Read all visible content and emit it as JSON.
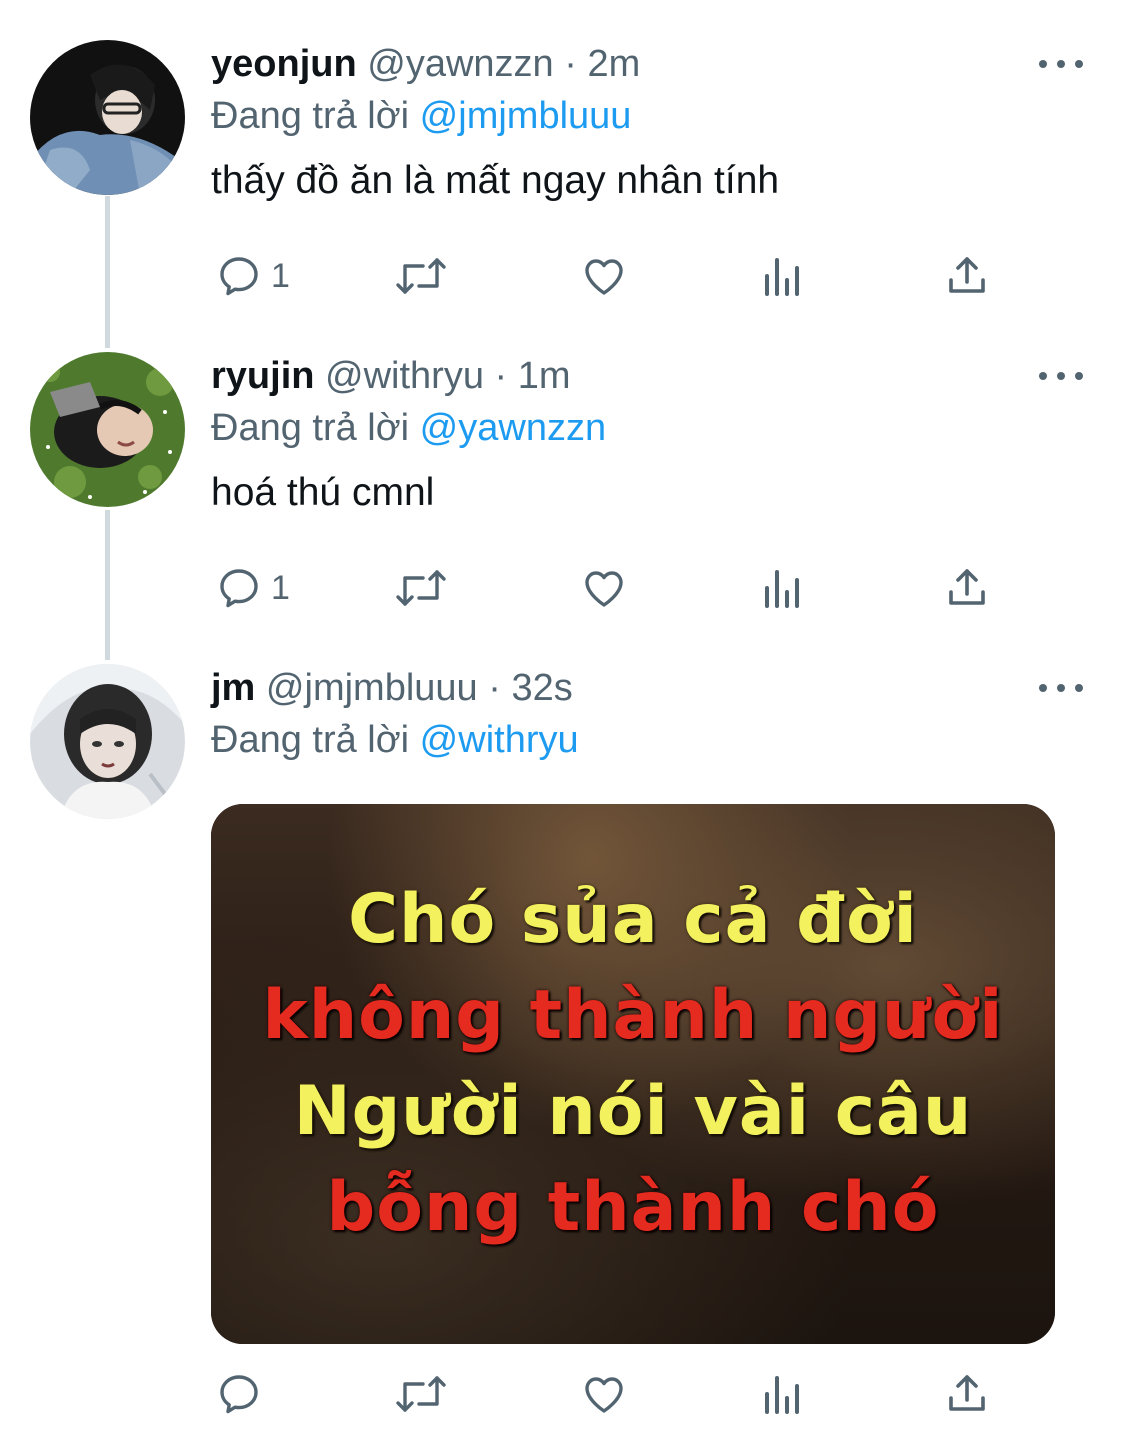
{
  "tweets": [
    {
      "display_name": "yeonjun",
      "handle": "@yawnzzn",
      "separator": "·",
      "time": "2m",
      "reply_prefix": "Đang trả lời",
      "reply_to": "@jmjmbluuu",
      "text": "thấy đồ ăn là mất ngay nhân tính",
      "reply_count": "1",
      "avatar_icon": "avatar-yeonjun"
    },
    {
      "display_name": "ryujin",
      "handle": "@withryu",
      "separator": "·",
      "time": "1m",
      "reply_prefix": "Đang trả lời",
      "reply_to": "@yawnzzn",
      "text": "hoá thú cmnl",
      "reply_count": "1",
      "avatar_icon": "avatar-ryujin"
    },
    {
      "display_name": "jm",
      "handle": "@jmjmbluuu",
      "separator": "·",
      "time": "32s",
      "reply_prefix": "Đang trả lời",
      "reply_to": "@withryu",
      "reply_count": "",
      "avatar_icon": "avatar-jm",
      "media": {
        "lines": [
          "Chó sủa cả đời",
          "không thành người",
          "Người nói vài câu",
          "bỗng thành chó"
        ],
        "colors": [
          "#f3f25e",
          "#e52a1f",
          "#f3f25e",
          "#e52a1f"
        ]
      }
    }
  ],
  "colors": {
    "link": "#1d9bf0",
    "secondary_text": "#536471",
    "thread_line": "#cfd9de"
  },
  "icons": [
    "comment-icon",
    "retweet-icon",
    "like-icon",
    "analytics-icon",
    "share-icon",
    "more-icon"
  ]
}
